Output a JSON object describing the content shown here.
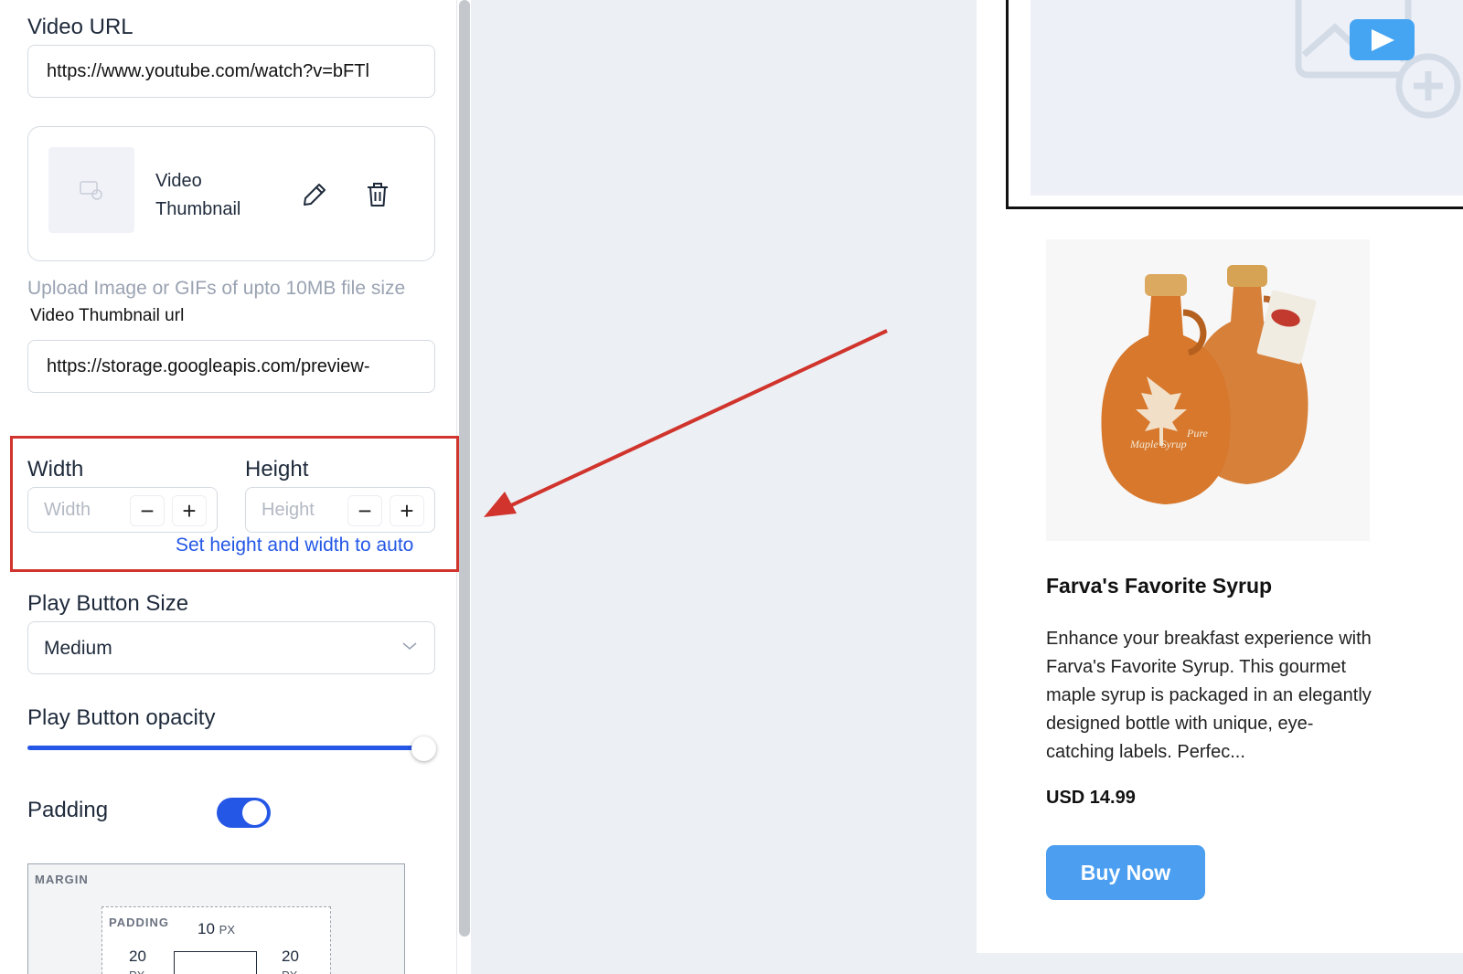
{
  "panel": {
    "video_url_label": "Video URL",
    "video_url_value": "https://www.youtube.com/watch?v=bFTl",
    "thumbnail_label_line1": "Video",
    "thumbnail_label_line2": "Thumbnail",
    "upload_hint": "Upload Image or GIFs of upto 10MB file size",
    "thumbnail_url_label": "Video Thumbnail url",
    "thumbnail_url_value": "https://storage.googleapis.com/preview-",
    "width_label": "Width",
    "width_placeholder": "Width",
    "height_label": "Height",
    "height_placeholder": "Height",
    "minus_symbol": "−",
    "plus_symbol": "+",
    "auto_link": "Set height and width to auto",
    "play_button_size_label": "Play Button Size",
    "play_button_size_value": "Medium",
    "play_button_opacity_label": "Play Button opacity",
    "play_button_opacity_value": 1.0,
    "padding_label": "Padding",
    "padding_enabled": true,
    "box_model": {
      "margin_tag": "MARGIN",
      "padding_tag": "PADDING",
      "top_value": "10",
      "left_value": "20",
      "right_value": "20",
      "unit": "PX"
    }
  },
  "preview": {
    "product_title": "Farva's Favorite Syrup",
    "product_description": "Enhance your breakfast experience with Farva's Favorite Syrup. This gourmet maple syrup is packaged in an elegantly designed bottle with unique, eye-catching labels. Perfec...",
    "bottle_label_line1": "Pure",
    "bottle_label_line2": "Maple Syrup",
    "price": "USD 14.99",
    "buy_button": "Buy Now"
  },
  "colors": {
    "accent_blue": "#2557e6",
    "highlight_red": "#d0342c",
    "buy_button": "#4b9ef0",
    "play_button": "#45a5f2",
    "canvas_bg": "#ecf0f5"
  },
  "icons": [
    "image-placeholder-icon",
    "pencil-icon",
    "trash-icon",
    "chevron-down-icon",
    "play-icon",
    "add-video-icon"
  ]
}
